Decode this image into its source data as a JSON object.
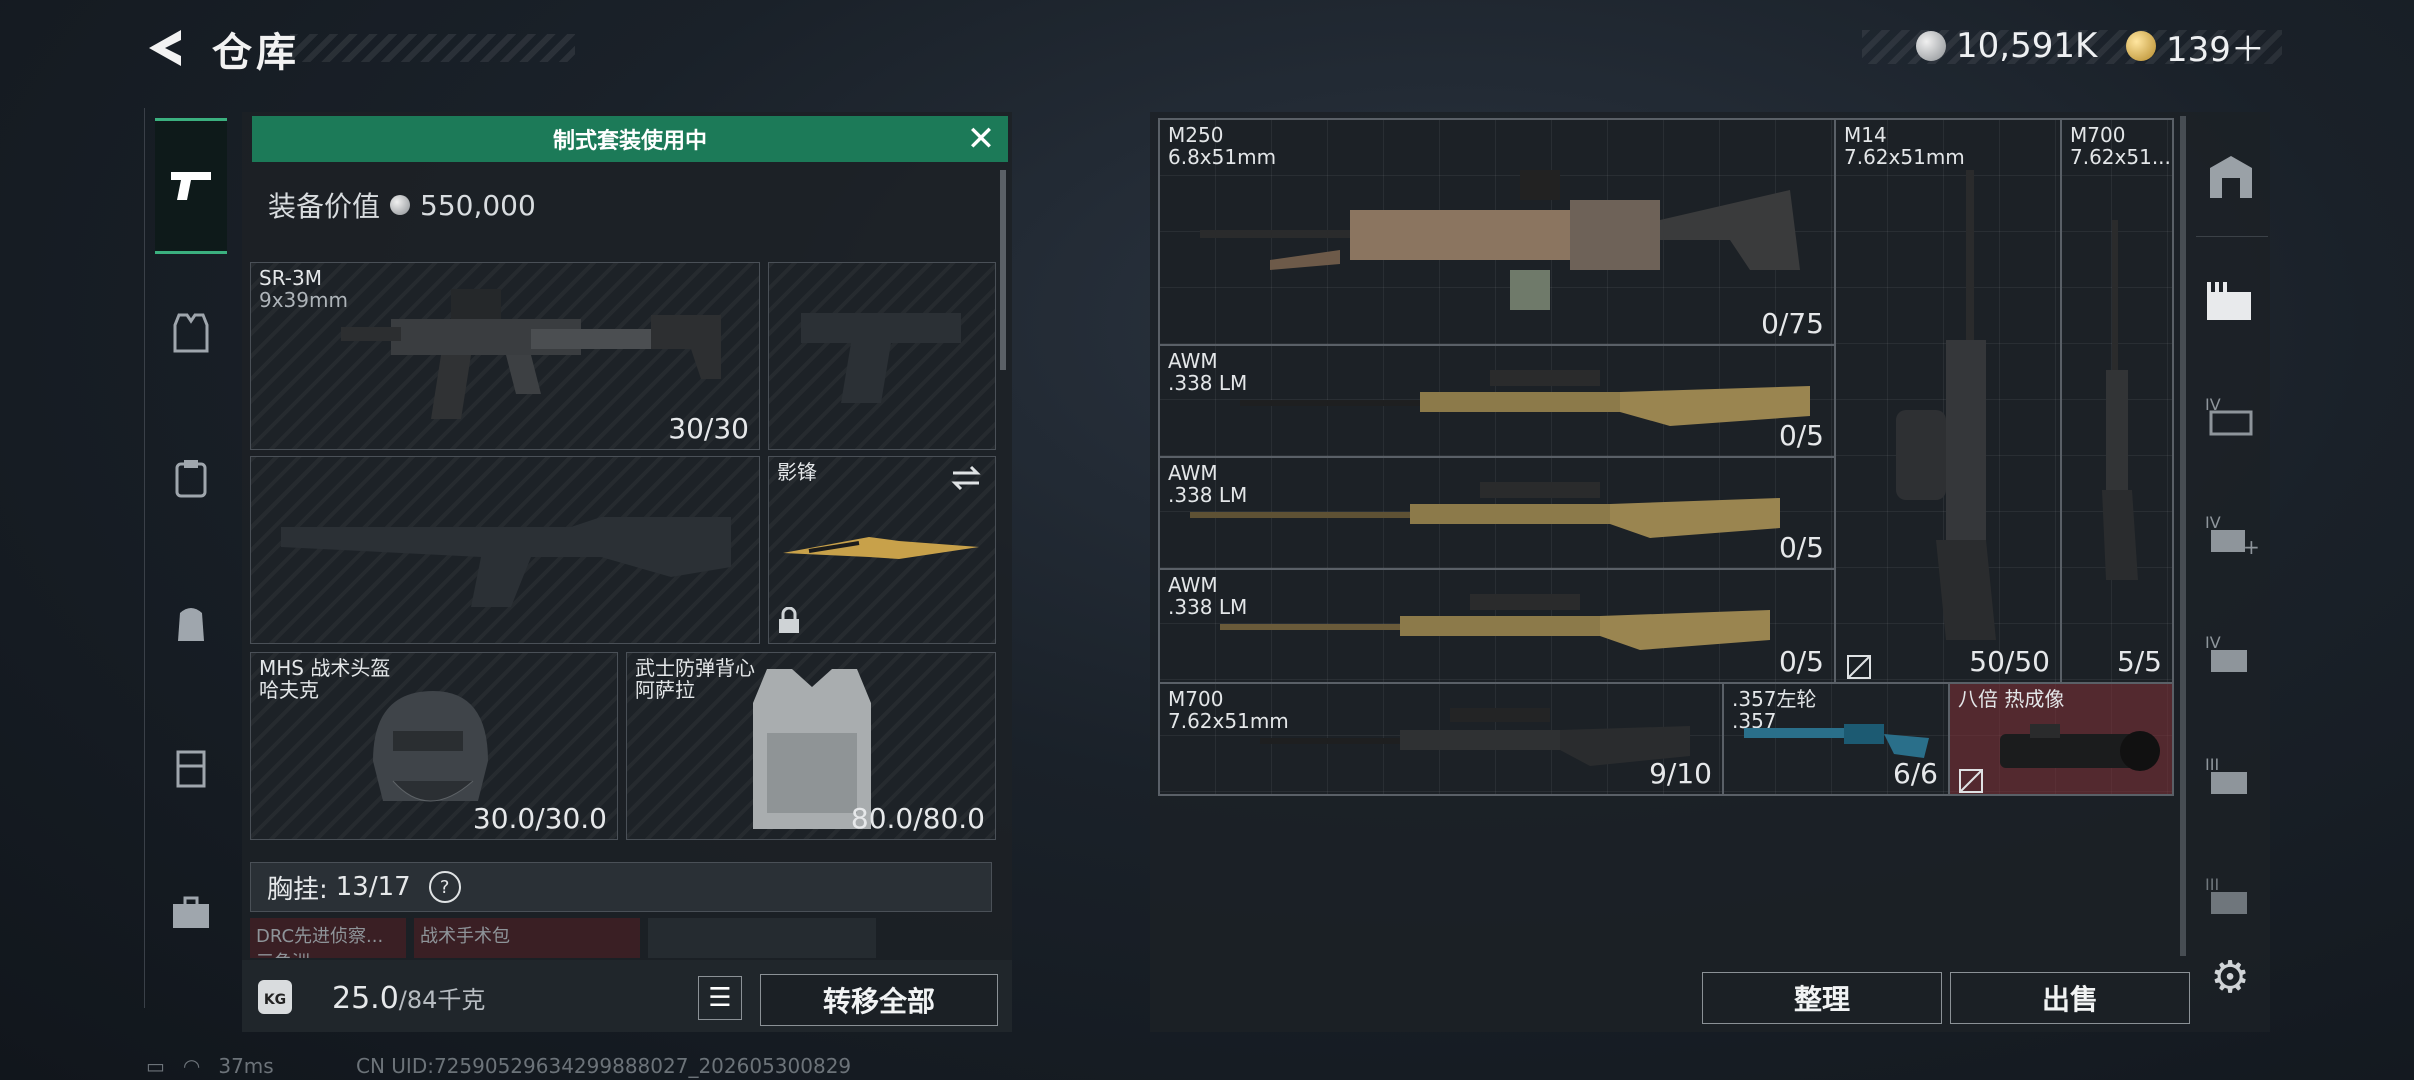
{
  "header": {
    "title": "仓库",
    "silver_amount": "10,591K",
    "gold_amount": "139＋"
  },
  "left_tabs": [
    {
      "id": "weapon",
      "icon": "pistol-icon",
      "active": true
    },
    {
      "id": "vest",
      "icon": "vest-icon",
      "active": false
    },
    {
      "id": "armor",
      "icon": "armor-icon",
      "active": false
    },
    {
      "id": "backpack",
      "icon": "backpack-icon",
      "active": false
    },
    {
      "id": "rig",
      "icon": "rig-icon",
      "active": false
    },
    {
      "id": "case",
      "icon": "case-icon",
      "active": false
    }
  ],
  "loadout": {
    "banner": "制式套装使用中",
    "value_label": "装备价值",
    "value": "550,000",
    "primary": {
      "name": "SR-3M",
      "caliber": "9x39mm",
      "count": "30/30"
    },
    "melee": {
      "name": "影锋"
    },
    "helmet": {
      "name": "MHS 战术头盔",
      "sub": "哈夫克",
      "durability": "30.0/30.0"
    },
    "vest": {
      "name": "武士防弹背心",
      "sub": "阿萨拉",
      "durability": "80.0/80.0"
    },
    "chest_label": "胸挂:",
    "chest_value": "13/17",
    "help": "?",
    "pouches": [
      "DRC先进侦察...",
      "战术手术包"
    ],
    "pouch_sub": "三角洲",
    "weight": "25.0",
    "weight_max": "/84千克",
    "kg_badge": "KG",
    "transfer_all": "转移全部"
  },
  "storage": {
    "items": [
      {
        "name": "M250",
        "caliber": "6.8x51mm",
        "count": "0/75"
      },
      {
        "name": "M14",
        "caliber": "7.62x51mm",
        "count": "50/50"
      },
      {
        "name": "M700",
        "caliber": "7.62x51...",
        "count": "5/5"
      },
      {
        "name": "AWM",
        "caliber": ".338 LM",
        "count": "0/5"
      },
      {
        "name": "AWM",
        "caliber": ".338 LM",
        "count": "0/5"
      },
      {
        "name": "AWM",
        "caliber": ".338 LM",
        "count": "0/5"
      },
      {
        "name": "M700",
        "caliber": "7.62x51mm",
        "count": "9/10"
      },
      {
        "name": ".357左轮",
        "caliber": ".357",
        "count": "6/6"
      },
      {
        "name": "八倍 热成像",
        "caliber": "",
        "count": ""
      }
    ],
    "sort_button": "整理",
    "sell_button": "出售"
  },
  "status": {
    "ping": "37ms",
    "uid": "CN UID:7259052963429988802​7_202605300829"
  },
  "colors": {
    "accent_green": "#1c7a58",
    "highlight_red": "#823237"
  }
}
